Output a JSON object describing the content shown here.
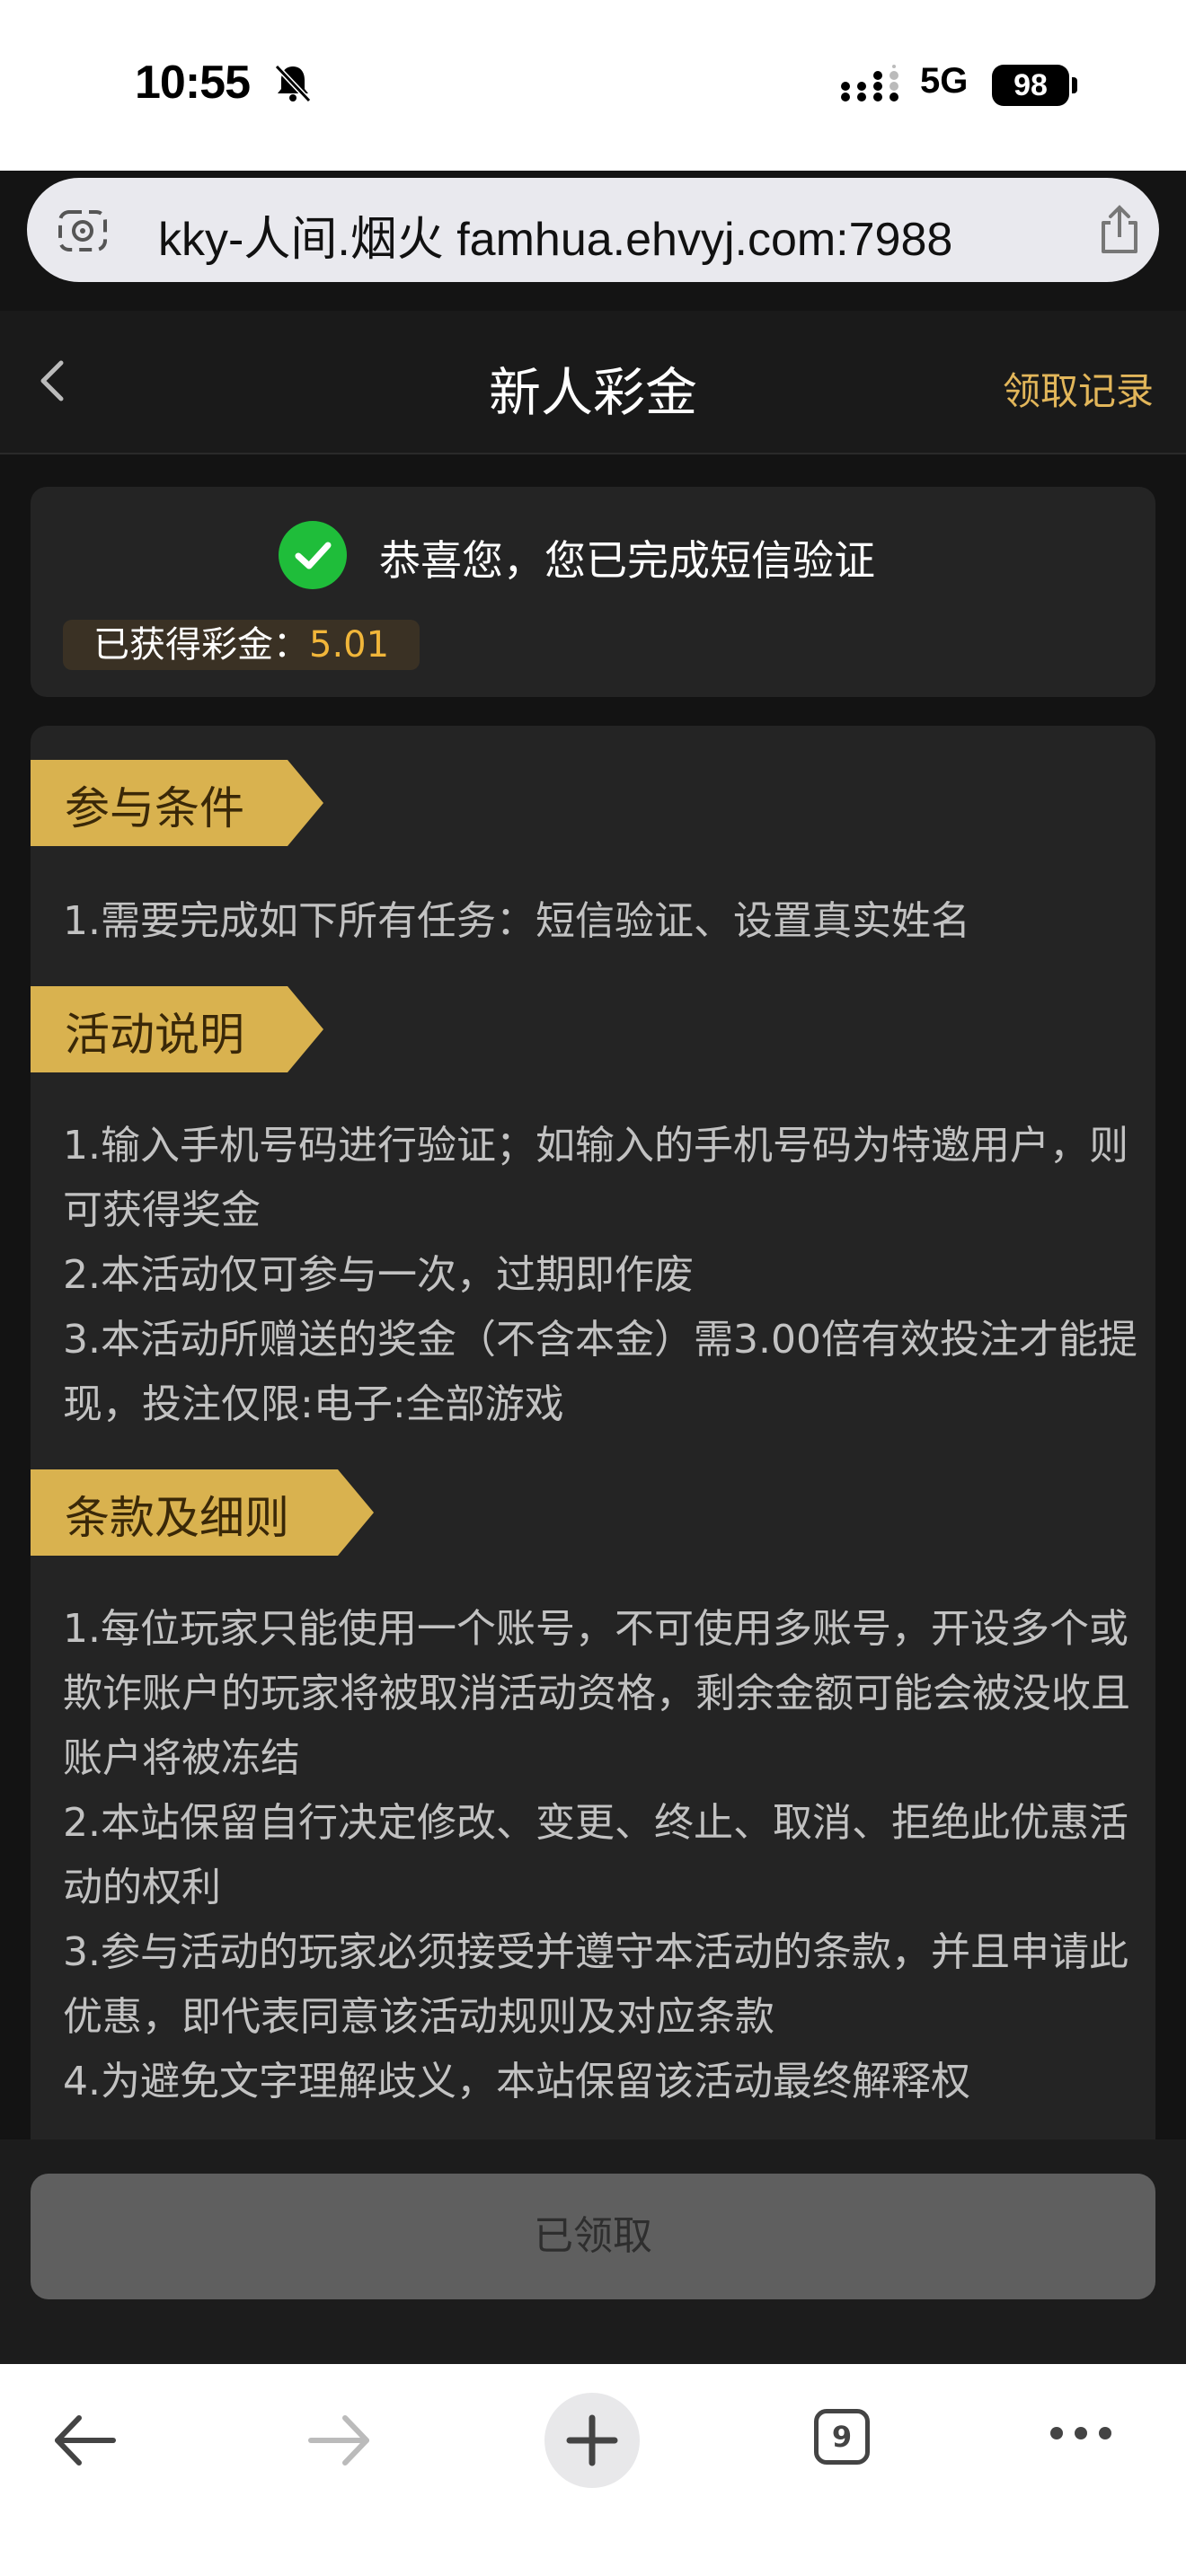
{
  "status_bar": {
    "time": "10:55",
    "network": "5G",
    "battery": "98"
  },
  "browser": {
    "url": "kky-人间.烟火 famhua.ehvyj.com:7988",
    "tab_count": "9"
  },
  "header": {
    "title": "新人彩金",
    "record_label": "领取记录"
  },
  "verify_card": {
    "message": "恭喜您，您已完成短信验证",
    "bonus_label": "已获得彩金：",
    "bonus_amount": "5.01"
  },
  "sections": {
    "conditions": {
      "title": "参与条件",
      "lines": [
        "1.需要完成如下所有任务：短信验证、设置真实姓名"
      ]
    },
    "description": {
      "title": "活动说明",
      "lines": [
        "1.输入手机号码进行验证；如输入的手机号码为特邀用户，则可获得奖金",
        "2.本活动仅可参与一次，过期即作废",
        "3.本活动所赠送的奖金（不含本金）需3.00倍有效投注才能提现，投注仅限:电子:全部游戏"
      ]
    },
    "terms": {
      "title": "条款及细则",
      "lines": [
        "1.每位玩家只能使用一个账号，不可使用多账号，开设多个或欺诈账户的玩家将被取消活动资格，剩余金额可能会被没收且账户将被冻结",
        "2.本站保留自行决定修改、变更、终止、取消、拒绝此优惠活动的权利",
        "3.参与活动的玩家必须接受并遵守本活动的条款，并且申请此优惠，即代表同意该活动规则及对应条款",
        "4.为避免文字理解歧义，本站保留该活动最终解释权"
      ]
    }
  },
  "claim_button": {
    "label": "已领取"
  },
  "colors": {
    "accent": "#e2b65a",
    "bonus_amount": "#f1b63a",
    "tag": "#d9b24f",
    "success": "#1fbd3a"
  },
  "icons": [
    "bell-slash-icon",
    "signal-icon",
    "lens-icon",
    "share-icon",
    "back-chevron-icon",
    "check-icon",
    "back-arrow-icon",
    "forward-arrow-icon",
    "plus-icon",
    "tabs-icon",
    "more-icon"
  ]
}
